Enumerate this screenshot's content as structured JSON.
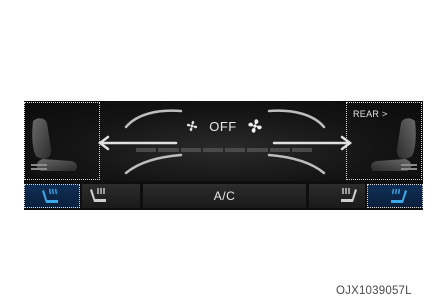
{
  "climate_panel": {
    "fan": {
      "status": "OFF",
      "small_fan_icon": "fan-low-icon",
      "big_fan_icon": "fan-high-icon",
      "level_segments_total": 8,
      "level_segments_active": 0
    },
    "rear_button": "REAR >",
    "ac_button": "A/C",
    "driver_zone_icon": "driver-seat-icon",
    "passenger_zone_icon": "passenger-seat-icon",
    "seat_heat_icon": "heated-seat-icon",
    "seat_vent_icon": "ventilated-seat-icon",
    "colors": {
      "panel": "#0e0e0e",
      "text": "#e8e8e8",
      "heat_button_active": "#0f2e55",
      "heat_glyph": "#3aa8e8",
      "dotted_outline": "#d8d8d8"
    }
  },
  "figure_code": "OJX1039057L"
}
